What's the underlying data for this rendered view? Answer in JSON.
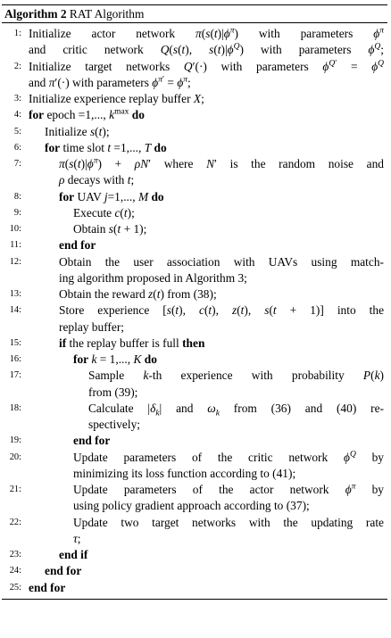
{
  "caption": {
    "label": "Algorithm 2",
    "title": "RAT Algorithm"
  },
  "lines": [
    {
      "no": "1:",
      "text": "Initialize actor network π(s(t)|ϕ^π) with parameters ϕ^π"
    },
    {
      "no": "",
      "text": "and critic network Q(s(t), s(t)|ϕ^Q) with parameters ϕ^Q;"
    },
    {
      "no": "2:",
      "text": "Initialize target networks Q′(·) with parameters ϕ^Q′ = ϕ^Q"
    },
    {
      "no": "",
      "text": "and π′(·) with parameters ϕ^π′ = ϕ^π;"
    },
    {
      "no": "3:",
      "text": "Initialize experience replay buffer X;"
    },
    {
      "no": "4:",
      "text": "for epoch =1,..., k^max do"
    },
    {
      "no": "5:",
      "text": "Initialize s(t);"
    },
    {
      "no": "6:",
      "text": "for time slot t =1,..., T do"
    },
    {
      "no": "7:",
      "text": "π(s(t)|ϕ^π) + ρN′ where N′ is the random noise and"
    },
    {
      "no": "",
      "text": "ρ decays with t;"
    },
    {
      "no": "8:",
      "text": "for UAV j=1,..., M do"
    },
    {
      "no": "9:",
      "text": "Execute c(t);"
    },
    {
      "no": "10:",
      "text": "Obtain s(t + 1);"
    },
    {
      "no": "11:",
      "text": "end for"
    },
    {
      "no": "12:",
      "text": "Obtain the user association with UAVs using match-"
    },
    {
      "no": "",
      "text": "ing algorithm proposed in Algorithm 3;"
    },
    {
      "no": "13:",
      "text": "Obtain the reward z(t) from (38);"
    },
    {
      "no": "14:",
      "text": "Store experience [s(t), c(t), z(t), s(t + 1)] into the"
    },
    {
      "no": "",
      "text": "replay buffer;"
    },
    {
      "no": "15:",
      "text": "if the replay buffer is full then"
    },
    {
      "no": "16:",
      "text": "for k = 1,..., K do"
    },
    {
      "no": "17:",
      "text": "Sample k-th experience with probability P(k)"
    },
    {
      "no": "",
      "text": "from (39);"
    },
    {
      "no": "18:",
      "text": "Calculate |δ_k| and ω_k from (36) and (40) re-"
    },
    {
      "no": "",
      "text": "spectively;"
    },
    {
      "no": "19:",
      "text": "end for"
    },
    {
      "no": "20:",
      "text": "Update parameters of the critic network ϕ^Q by"
    },
    {
      "no": "",
      "text": "minimizing its loss function according to (41);"
    },
    {
      "no": "21:",
      "text": "Update parameters of the actor network ϕ^π by"
    },
    {
      "no": "",
      "text": "using policy gradient approach according to (37);"
    },
    {
      "no": "22:",
      "text": "Update two target networks with the updating rate"
    },
    {
      "no": "",
      "text": "τ;"
    },
    {
      "no": "23:",
      "text": "end if"
    },
    {
      "no": "24:",
      "text": "end for"
    },
    {
      "no": "25:",
      "text": "end for"
    }
  ]
}
